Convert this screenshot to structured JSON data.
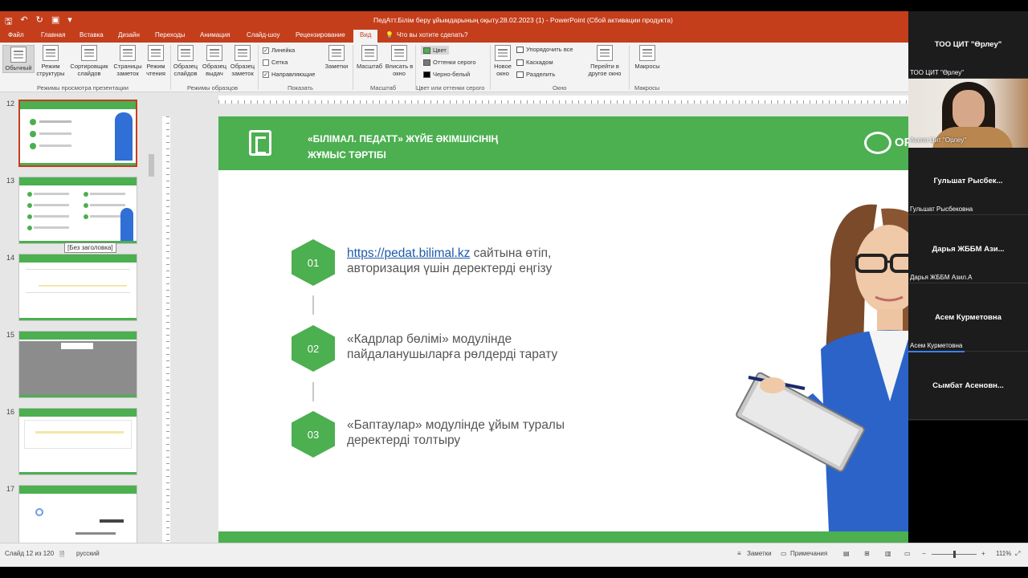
{
  "window": {
    "title": "ПедАтт.Білім беру ұйымдарының оқыту.28.02.2023 (1) - PowerPoint (Сбой активации продукта)"
  },
  "tabs": [
    "Файл",
    "Главная",
    "Вставка",
    "Дизайн",
    "Переходы",
    "Анимация",
    "Слайд-шоу",
    "Рецензирование",
    "Вид"
  ],
  "active_tab": "Вид",
  "tell_me": "Что вы хотите сделать?",
  "ribbon": {
    "buttons": {
      "normal": "Обычный",
      "outline": "Режим структуры",
      "sorter": "Сортировщик слайдов",
      "notes_page": "Страницы заметок",
      "reading": "Режим чтения",
      "slide_master": "Образец слайдов",
      "handout_master": "Образец выдач",
      "notes_master": "Образец заметок",
      "notes": "Заметки",
      "zoom": "Масштаб",
      "fit": "Вписать в окно",
      "new_window": "Новое окно",
      "switch_windows": "Перейти в другое окно",
      "macros": "Макросы"
    },
    "checkboxes": {
      "ruler": "Линейка",
      "grid": "Сетка",
      "guides": "Направляющие"
    },
    "color": {
      "color": "Цвет",
      "grayscale": "Оттенки серого",
      "bw": "Черно-белый"
    },
    "window_items": {
      "arrange": "Упорядочить все",
      "cascade": "Каскадом",
      "split": "Разделить"
    },
    "groups": {
      "presentation_views": "Режимы просмотра презентации",
      "master_views": "Режимы образцов",
      "show": "Показать",
      "zoom": "Масштаб",
      "color": "Цвет или оттенки серого",
      "window": "Окно",
      "macros": "Макросы"
    }
  },
  "thumbnails": {
    "numbers": [
      "12",
      "13",
      "14",
      "15",
      "16",
      "17"
    ],
    "selected": "12",
    "tooltip": "[Без заголовка]"
  },
  "slide": {
    "title_line1": "«БІЛІМАЛ. ПЕДАТТ» ЖҮЙЕ ӘКІМШІСІНІҢ",
    "title_line2": "ЖҰМЫС ТӘРТІБІ",
    "brand": "ОР",
    "steps": [
      {
        "num": "01",
        "link": "https://pedat.bilimal.kz",
        "text_a": " сайтына өтіп,",
        "text_b": "авторизация үшін деректерді еңгізу"
      },
      {
        "num": "02",
        "text_a": "«Кадрлар бөлімі» модулінде",
        "text_b": "пайдаланушыларға рөлдерді тарату"
      },
      {
        "num": "03",
        "text_a": "«Баптаулар» модулінде ұйым туралы",
        "text_b": "деректерді толтыру"
      }
    ]
  },
  "status": {
    "slide": "Слайд 12 из 120",
    "lang": "русский",
    "notes": "Заметки",
    "comments": "Примечания",
    "zoom": "111%"
  },
  "participants": [
    {
      "name": "ТОО ЦИТ \"Өрлеу\"",
      "sub": "ТОО ЦИТ \"Өрлеу\""
    },
    {
      "name": "",
      "sub": "Аселя Цит \"Орлеу\""
    },
    {
      "name": "Гульшат Рысбек...",
      "sub": "Гульшат Рысбековна"
    },
    {
      "name": "Дарья ЖББМ Ази...",
      "sub": "Дарья ЖББМ Азил.А"
    },
    {
      "name": "Асем Курметовна",
      "sub": "Асем Курметовна"
    },
    {
      "name": "Сымбат Асеновн...",
      "sub": ""
    }
  ],
  "colors": {
    "ppt_accent": "#c43e1c",
    "slide_green": "#4caf50",
    "link": "#1e5aa8"
  }
}
